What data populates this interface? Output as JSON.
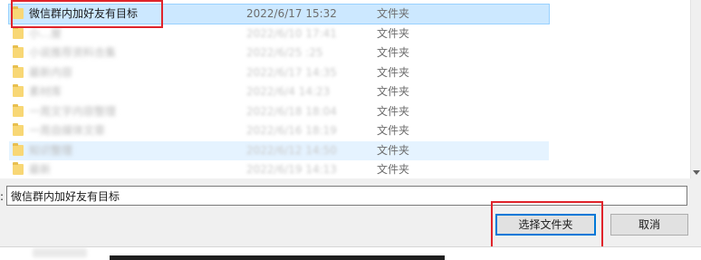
{
  "files": [
    {
      "name": "微信群内加好友有目标",
      "date": "2022/6/17 15:32",
      "type": "文件夹",
      "state": "selected",
      "blurred": false
    },
    {
      "name": "小…屋",
      "date": "2022/6/10 17:41",
      "type": "文件夹",
      "state": "normal",
      "blurred": true
    },
    {
      "name": "小说推荐资料合集",
      "date": "2022/6/25 :25",
      "type": "文件夹",
      "state": "normal",
      "blurred": true
    },
    {
      "name": "最新内容",
      "date": "2022/6/17 14:35",
      "type": "文件夹",
      "state": "normal",
      "blurred": true
    },
    {
      "name": "素材库",
      "date": "2022/6/4 14:23",
      "type": "文件夹",
      "state": "normal",
      "blurred": true
    },
    {
      "name": "一周文字内容整理",
      "date": "2022/6/18 18:04",
      "type": "文件夹",
      "state": "normal",
      "blurred": true
    },
    {
      "name": "一周自媒体文章",
      "date": "2022/6/16 18:19",
      "type": "文件夹",
      "state": "normal",
      "blurred": true
    },
    {
      "name": "知识整理",
      "date": "2022/6/12 14:50",
      "type": "文件夹",
      "state": "hover",
      "blurred": true
    },
    {
      "name": "最新",
      "date": "2022/6/19 14:13",
      "type": "文件夹",
      "state": "normal",
      "blurred": true
    }
  ],
  "filename": {
    "label": ":",
    "value": "微信群内加好友有目标"
  },
  "buttons": {
    "select_folder": "选择文件夹",
    "cancel": "取消"
  },
  "colors": {
    "selection": "#cce8ff",
    "hover": "#e5f3ff",
    "highlight_box": "#e0242b",
    "folder": "#f8d775",
    "primary_button_border": "#0078d7"
  },
  "icons": {
    "folder": "folder-icon",
    "scroll_down": "scroll-down-arrow-icon"
  }
}
